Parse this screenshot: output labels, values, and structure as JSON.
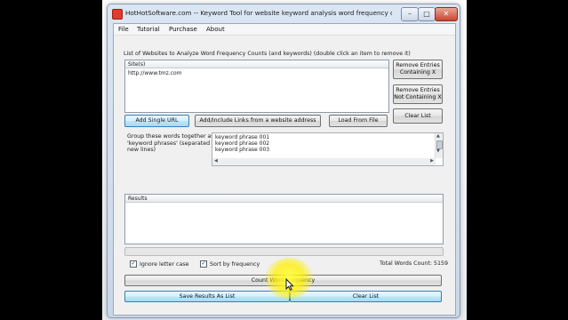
{
  "window": {
    "title": "HotHotSoftware.com -- Keyword Tool for website keyword analysis word frequency count and searc...",
    "minimize_glyph": "–",
    "maximize_glyph": "□",
    "close_glyph": "✕"
  },
  "menu": {
    "items": [
      "File",
      "Tutorial",
      "Purchase",
      "About"
    ]
  },
  "websites": {
    "section_label": "List of Websites to Analyze Word Frequency Counts (and keywords) (double click an item to remove it)",
    "column_header": "Site(s)",
    "sites": [
      "http://www.tmz.com"
    ],
    "add_single_url": "Add Single URL",
    "add_links": "Add/Include Links from a website address",
    "load_from_file": "Load From File",
    "remove_containing_line1": "Remove Entries",
    "remove_containing_line2": "Containing X",
    "remove_not_containing_line1": "Remove Entries",
    "remove_not_containing_line2": "Not Containing X",
    "clear_list": "Clear List"
  },
  "phrases": {
    "label_line1": "Group these words together as",
    "label_line2": "'keyword phrases' (separated by",
    "label_line3": "new lines)",
    "lines": [
      "keyword phrase 001",
      "keyword phrase 002",
      "keyword phrase 003"
    ]
  },
  "results": {
    "column_header": "Results"
  },
  "options": {
    "ignore_case_label": "Ignore letter case",
    "ignore_case_checked": true,
    "sort_by_frequency_label": "Sort by frequency",
    "sort_by_frequency_checked": true,
    "total_words": "Total Words Count: 5159"
  },
  "actions": {
    "count_word_frequency": "Count Word Frequency",
    "save_results": "Save Results As List",
    "clear_list": "Clear List"
  },
  "colors": {
    "accent": "#3c7fb1",
    "highlight": "#fff23c"
  }
}
